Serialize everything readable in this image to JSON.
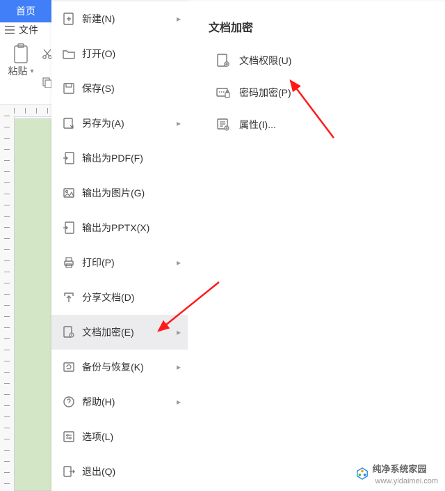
{
  "tabs": {
    "home": "首页"
  },
  "fileMenuLabel": "文件",
  "toolbar": {
    "paste": "粘贴"
  },
  "menu": [
    {
      "label": "新建(N)",
      "has_sub": true
    },
    {
      "label": "打开(O)",
      "has_sub": false
    },
    {
      "label": "保存(S)",
      "has_sub": false
    },
    {
      "label": "另存为(A)",
      "has_sub": true
    },
    {
      "label": "输出为PDF(F)",
      "has_sub": false
    },
    {
      "label": "输出为图片(G)",
      "has_sub": false
    },
    {
      "label": "输出为PPTX(X)",
      "has_sub": false
    },
    {
      "label": "打印(P)",
      "has_sub": true
    },
    {
      "label": "分享文档(D)",
      "has_sub": false
    },
    {
      "label": "文档加密(E)",
      "has_sub": true,
      "active": true
    },
    {
      "label": "备份与恢复(K)",
      "has_sub": true
    },
    {
      "label": "帮助(H)",
      "has_sub": true
    },
    {
      "label": "选项(L)",
      "has_sub": false
    },
    {
      "label": "退出(Q)",
      "has_sub": false
    }
  ],
  "submenu": {
    "header": "文档加密",
    "items": [
      {
        "label": "文档权限(U)"
      },
      {
        "label": "密码加密(P)"
      },
      {
        "label": "属性(I)..."
      }
    ]
  },
  "watermark": {
    "text": "纯净系统家园",
    "url": "www.yidaimei.com"
  },
  "colors": {
    "accent": "#417ff9",
    "arrow": "#ff1a1a"
  }
}
